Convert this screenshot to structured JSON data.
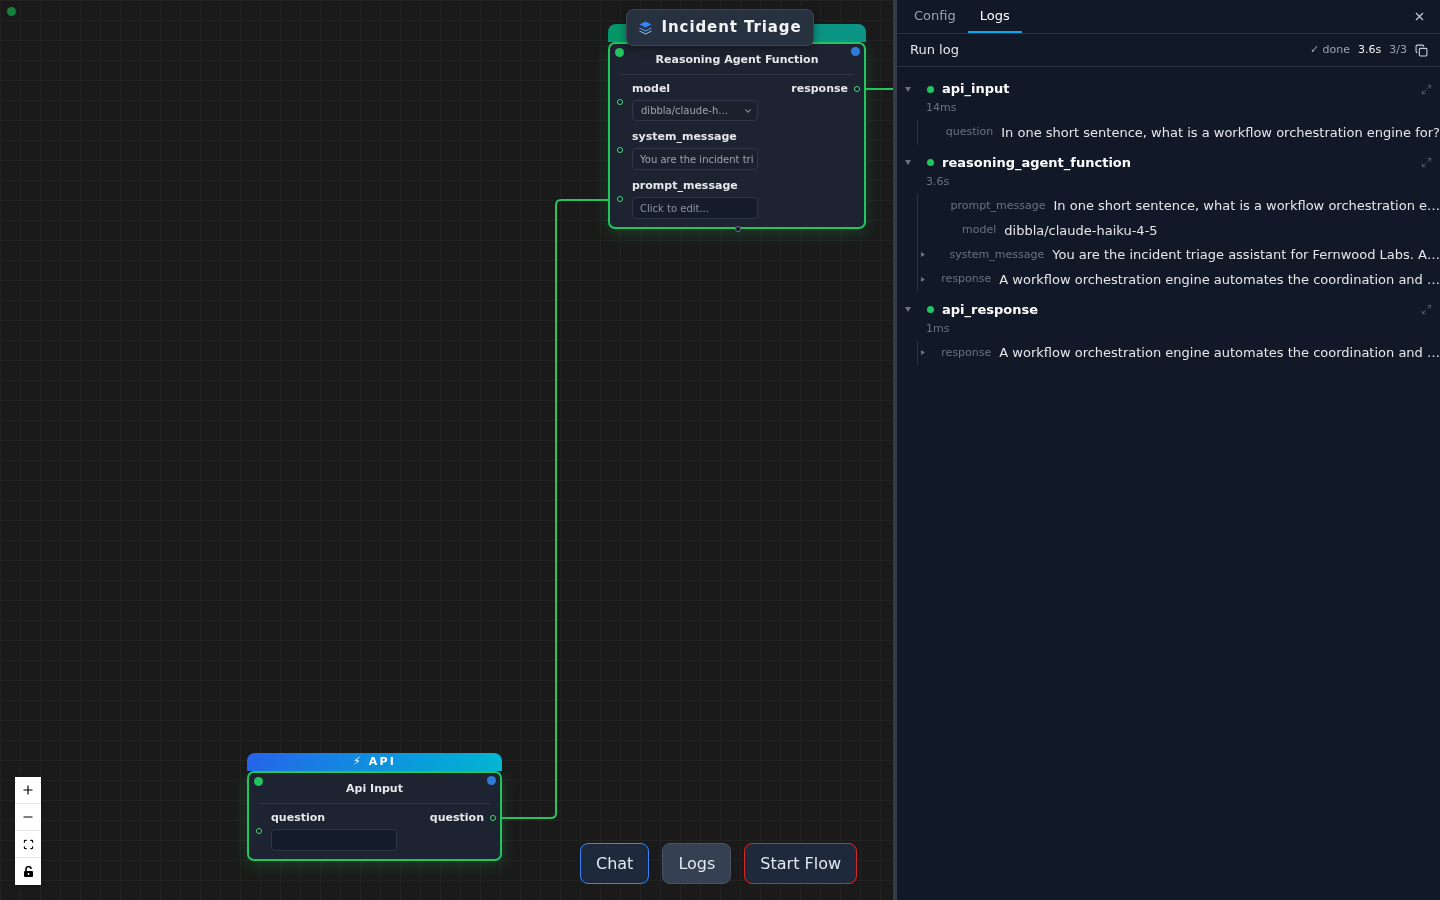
{
  "canvas": {
    "nodes": [
      {
        "kind": "agent",
        "badge": "Incident Triage",
        "title": "Reasoning Agent Function",
        "inputs": [
          {
            "label": "model",
            "kind": "select",
            "value": "dibbla/claude-h…"
          },
          {
            "label": "system_message",
            "kind": "text",
            "value": "You are the incident tri"
          },
          {
            "label": "prompt_message",
            "kind": "text",
            "placeholder": "Click to edit..."
          }
        ],
        "outputs": [
          {
            "label": "response"
          }
        ]
      },
      {
        "kind": "api",
        "header": "⚡ API",
        "title": "Api Input",
        "inputs": [
          {
            "label": "question",
            "kind": "text"
          }
        ],
        "outputs": [
          {
            "label": "question"
          }
        ]
      }
    ],
    "actions": [
      {
        "label": "Chat",
        "kind": "chat",
        "selected": false
      },
      {
        "label": "Logs",
        "kind": "logs",
        "selected": true
      },
      {
        "label": "Start Flow",
        "kind": "run",
        "selected": false
      }
    ]
  },
  "panel": {
    "tabs": [
      {
        "label": "Config",
        "selected": false
      },
      {
        "label": "Logs",
        "selected": true
      }
    ],
    "run_log": {
      "title": "Run log",
      "status": "✓ done",
      "duration": "3.6s",
      "progress": "3/3",
      "entries": [
        {
          "name": "api_input",
          "expanded": true,
          "duration": "14ms",
          "fields": [
            {
              "key": "question",
              "value": "In one short sentence, what is a workflow orchestration engine for?",
              "expandable": false
            }
          ]
        },
        {
          "name": "reasoning_agent_function",
          "expanded": true,
          "duration": "3.6s",
          "fields": [
            {
              "key": "prompt_message",
              "value": "In one short sentence, what is a workflow orchestration e…",
              "expandable": false
            },
            {
              "key": "model",
              "value": "dibbla/claude-haiku-4-5",
              "expandable": false
            },
            {
              "key": "system_message",
              "value": "You are the incident triage assistant for Fernwood Labs. A…",
              "expandable": true
            },
            {
              "key": "response",
              "value": "A workflow orchestration engine automates the coordination and …",
              "expandable": true
            }
          ]
        },
        {
          "name": "api_response",
          "expanded": true,
          "duration": "1ms",
          "fields": [
            {
              "key": "response",
              "value": "A workflow orchestration engine automates the coordination and …",
              "expandable": true
            }
          ]
        }
      ]
    }
  }
}
